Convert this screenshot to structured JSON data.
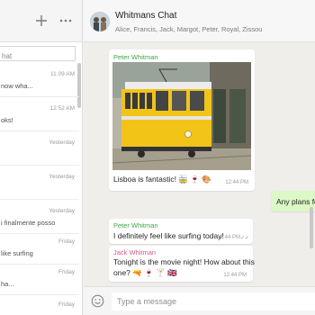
{
  "colors": {
    "accent_green": "#4caf50",
    "sender_green": "#3fa64a",
    "sender_pink": "#d9578a",
    "outgoing_bubble": "#dcf8c6",
    "chat_background": "#efeeea",
    "tram_yellow": "#f2c418"
  },
  "sidebar": {
    "header_icons": [
      "plus-icon",
      "more-dots-icon"
    ],
    "search": {
      "placeholder": "hat",
      "value": ""
    },
    "chats": [
      {
        "time": "11:09 AM",
        "preview": "now wha..."
      },
      {
        "time": "12:52 AM",
        "preview": "oks!"
      },
      {
        "time": "Yesterday",
        "preview": ""
      },
      {
        "time": "Yesterday",
        "preview": ""
      },
      {
        "time": "Yesterday",
        "preview": "i finalmente posso"
      },
      {
        "time": "Friday",
        "preview": "like surfing"
      },
      {
        "time": "Friday",
        "preview": "ha..."
      },
      {
        "time": "Friday",
        "preview": ""
      }
    ]
  },
  "chat": {
    "title": "Whitmans Chat",
    "members": "Alice, Francis, Jack, Margot, Peter, Royal, Zissou",
    "messages": [
      {
        "type": "photo",
        "sender": "Peter Whitman",
        "text": "Lisboa is fantastic! 🚋 🍷 🎨",
        "time": "12:44 PM"
      },
      {
        "type": "outgoing",
        "text": "Any plans for"
      },
      {
        "type": "text",
        "sender": "Peter Whitman",
        "text": "I definitely feel like surfing today!",
        "time": "12:44 PM",
        "status": "✓✓"
      },
      {
        "type": "text",
        "sender": "Jack Whitman",
        "text_line1": "Tonight is the movie night! How about this",
        "text_line2": "one? 🔫 🍷 🍸 🇬🇧",
        "time": "12:44 PM"
      }
    ]
  },
  "composer": {
    "placeholder": "Type a message",
    "value": "",
    "emoji_icon": "smiley-icon"
  }
}
